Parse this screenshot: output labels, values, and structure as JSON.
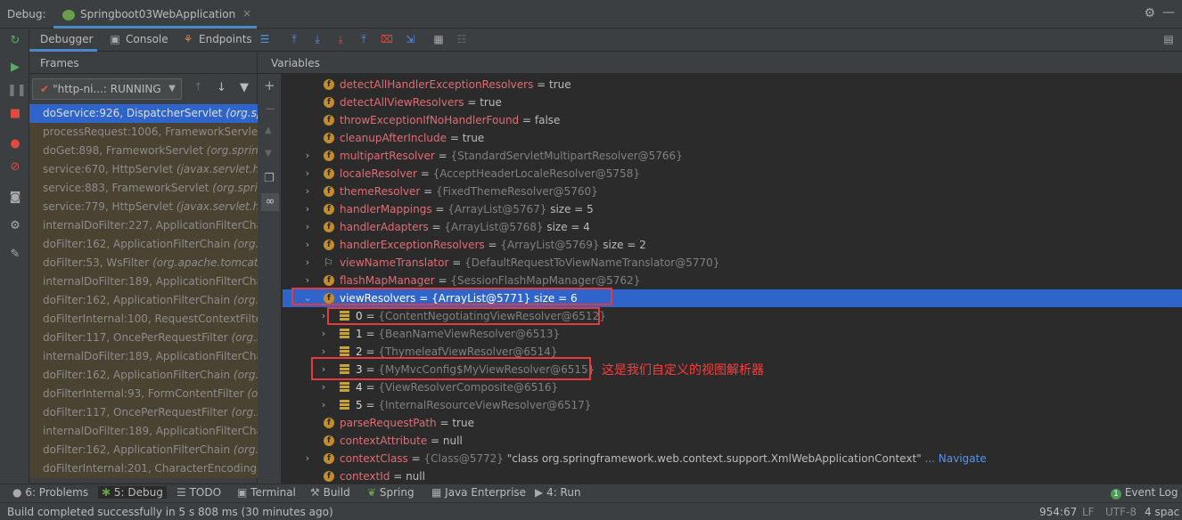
{
  "titlebar": {
    "label": "Debug:",
    "tab": "Springboot03WebApplication"
  },
  "tabs": {
    "debugger": "Debugger",
    "console": "Console",
    "endpoints": "Endpoints"
  },
  "frames": {
    "header": "Frames",
    "thread": "\"http-ni...: RUNNING",
    "items": [
      {
        "method": "doService:926, DispatcherServlet",
        "cls": "(org.spr"
      },
      {
        "method": "processRequest:1006, FrameworkServlet",
        "cls": ""
      },
      {
        "method": "doGet:898, FrameworkServlet",
        "cls": "(org.spring"
      },
      {
        "method": "service:670, HttpServlet",
        "cls": "(javax.servlet.http"
      },
      {
        "method": "service:883, FrameworkServlet",
        "cls": "(org.spring"
      },
      {
        "method": "service:779, HttpServlet",
        "cls": "(javax.servlet.http"
      },
      {
        "method": "internalDoFilter:227, ApplicationFilterChai",
        "cls": ""
      },
      {
        "method": "doFilter:162, ApplicationFilterChain",
        "cls": "(org.ap"
      },
      {
        "method": "doFilter:53, WsFilter",
        "cls": "(org.apache.tomcat.w"
      },
      {
        "method": "internalDoFilter:189, ApplicationFilterChai",
        "cls": ""
      },
      {
        "method": "doFilter:162, ApplicationFilterChain",
        "cls": "(org.ap"
      },
      {
        "method": "doFilterInternal:100, RequestContextFilter",
        "cls": ""
      },
      {
        "method": "doFilter:117, OncePerRequestFilter",
        "cls": "(org.sp"
      },
      {
        "method": "internalDoFilter:189, ApplicationFilterChai",
        "cls": ""
      },
      {
        "method": "doFilter:162, ApplicationFilterChain",
        "cls": "(org.ap"
      },
      {
        "method": "doFilterInternal:93, FormContentFilter",
        "cls": "(org"
      },
      {
        "method": "doFilter:117, OncePerRequestFilter",
        "cls": "(org.sp"
      },
      {
        "method": "internalDoFilter:189, ApplicationFilterChai",
        "cls": ""
      },
      {
        "method": "doFilter:162, ApplicationFilterChain",
        "cls": "(org.ap"
      },
      {
        "method": "doFilterInternal:201, CharacterEncodingFil",
        "cls": ""
      }
    ]
  },
  "variables": {
    "header": "Variables",
    "rows": [
      {
        "name": "detectAllHandlerExceptionResolvers",
        "ref": "",
        "val": "true"
      },
      {
        "name": "detectAllViewResolvers",
        "ref": "",
        "val": "true"
      },
      {
        "name": "throwExceptionIfNoHandlerFound",
        "ref": "",
        "val": "false"
      },
      {
        "name": "cleanupAfterInclude",
        "ref": "",
        "val": "true"
      },
      {
        "name": "multipartResolver",
        "ref": "{StandardServletMultipartResolver@5766}",
        "val": ""
      },
      {
        "name": "localeResolver",
        "ref": "{AcceptHeaderLocaleResolver@5758}",
        "val": ""
      },
      {
        "name": "themeResolver",
        "ref": "{FixedThemeResolver@5760}",
        "val": ""
      },
      {
        "name": "handlerMappings",
        "ref": "{ArrayList@5767}",
        "val": "size = 5"
      },
      {
        "name": "handlerAdapters",
        "ref": "{ArrayList@5768}",
        "val": "size = 4"
      },
      {
        "name": "handlerExceptionResolvers",
        "ref": "{ArrayList@5769}",
        "val": "size = 2"
      },
      {
        "name": "viewNameTranslator",
        "ref": "{DefaultRequestToViewNameTranslator@5770}",
        "val": ""
      },
      {
        "name": "flashMapManager",
        "ref": "{SessionFlashMapManager@5762}",
        "val": ""
      },
      {
        "name": "viewResolvers",
        "ref": "{ArrayList@5771}",
        "val": "size = 6"
      },
      {
        "name": "0",
        "ref": "{ContentNegotiatingViewResolver@6512}",
        "val": ""
      },
      {
        "name": "1",
        "ref": "{BeanNameViewResolver@6513}",
        "val": ""
      },
      {
        "name": "2",
        "ref": "{ThymeleafViewResolver@6514}",
        "val": ""
      },
      {
        "name": "3",
        "ref": "{MyMvcConfig$MyViewResolver@6515}",
        "val": ""
      },
      {
        "name": "4",
        "ref": "{ViewResolverComposite@6516}",
        "val": ""
      },
      {
        "name": "5",
        "ref": "{InternalResourceViewResolver@6517}",
        "val": ""
      },
      {
        "name": "parseRequestPath",
        "ref": "",
        "val": "true"
      },
      {
        "name": "contextAttribute",
        "ref": "",
        "val": "null"
      },
      {
        "name": "contextClass",
        "ref": "{Class@5772}",
        "val": "\"class org.springframework.web.context.support.XmlWebApplicationContext\"",
        "nav": "... Navigate"
      },
      {
        "name": "contextId",
        "ref": "",
        "val": "null"
      }
    ],
    "annotation": "这是我们自定义的视图解析器"
  },
  "bottombar": {
    "problems": "6: Problems",
    "debug": "5: Debug",
    "todo": "TODO",
    "terminal": "Terminal",
    "build": "Build",
    "spring": "Spring",
    "java_enterprise": "Java Enterprise",
    "run": "4: Run",
    "event_log": "Event Log",
    "event_count": "1"
  },
  "status": {
    "message": "Build completed successfully in 5 s 808 ms (30 minutes ago)",
    "position": "954:67",
    "line_sep": "LF",
    "encoding": "UTF-8",
    "indent": "4 spac"
  }
}
